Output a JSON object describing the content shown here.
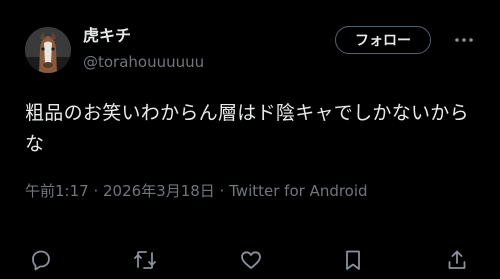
{
  "author": {
    "display_name": "虎キチ",
    "handle": "@torahouuuuuu",
    "avatar_icon": "horse-avatar-icon"
  },
  "header": {
    "follow_label": "フォロー",
    "more_icon": "more-dots-icon"
  },
  "tweet": {
    "text": "粗品のお笑いわからん層はド陰キャでしかないからな",
    "time": "午前1:17",
    "separator_1": " · ",
    "date": "2026年3月18日",
    "separator_2": " · ",
    "source": "Twitter for Android"
  },
  "actions": [
    {
      "icon": "reply-icon"
    },
    {
      "icon": "retweet-icon"
    },
    {
      "icon": "like-icon"
    },
    {
      "icon": "bookmark-icon"
    },
    {
      "icon": "share-icon"
    }
  ],
  "colors": {
    "background": "#000000",
    "primary_text": "#e7e9ea",
    "secondary_text": "#71767b",
    "border": "#536471"
  }
}
